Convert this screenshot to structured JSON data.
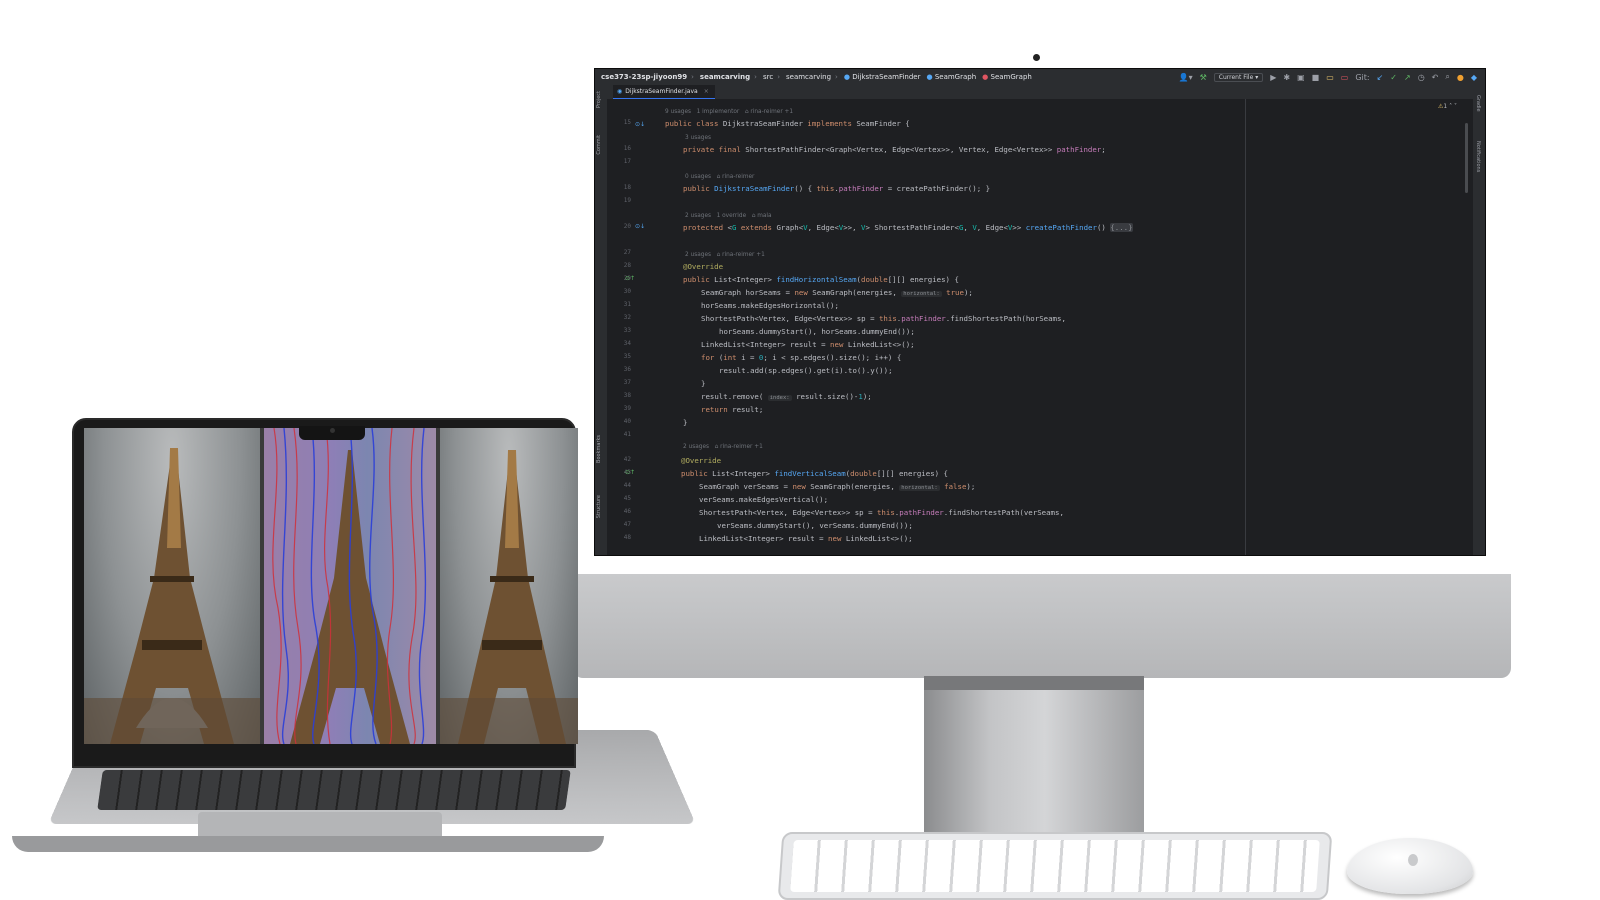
{
  "ide": {
    "breadcrumbs": [
      "cse373-23sp-jiyoon99",
      "seamcarving",
      "src",
      "seamcarving",
      "DijkstraSeamFinder",
      "SeamGraph",
      "SeamGraph"
    ],
    "run_config": "Current File",
    "git_label": "Git:",
    "tab": "DijkstraSeamFinder.java",
    "left_tools": [
      "Project",
      "Commit",
      "Bookmarks",
      "Structure"
    ],
    "right_tools": [
      "Gradle",
      "Notifications"
    ],
    "warnings": "1",
    "code": {
      "m1": "9 usages   1 implementor   ⌂ rina-reimer +1",
      "l15": "public class DijkstraSeamFinder implements SeamFinder {",
      "m2": "3 usages",
      "l16": "private final ShortestPathFinder<Graph<Vertex, Edge<Vertex>>, Vertex, Edge<Vertex>> pathFinder;",
      "m3": "0 usages   ⌂ rina-reimer",
      "l18": "public DijkstraSeamFinder() { this.pathFinder = createPathFinder(); }",
      "m4": "2 usages   1 override   ⌂ mala",
      "l20": "protected <G extends Graph<V, Edge<V>>, V> ShortestPathFinder<G, V, Edge<V>> createPathFinder() {...}",
      "m5": "2 usages   ⌂ rina-reimer +1",
      "l28": "@Override",
      "l29": "public List<Integer> findHorizontalSeam(double[][] energies) {",
      "l30": "SeamGraph horSeams = new SeamGraph(energies,  horizontal: true);",
      "l31": "horSeams.makeEdgesHorizontal();",
      "l32": "ShortestPath<Vertex, Edge<Vertex>> sp = this.pathFinder.findShortestPath(horSeams,",
      "l33": "horSeams.dummyStart(), horSeams.dummyEnd());",
      "l34": "LinkedList<Integer> result = new LinkedList<>();",
      "l35": "for (int i = 0; i < sp.edges().size(); i++) {",
      "l36": "result.add(sp.edges().get(i).to().y());",
      "l37": "}",
      "l38": "result.remove( index: result.size()-1);",
      "l39": "return result;",
      "l40": "}",
      "m6": "2 usages   ⌂ rina-reimer +1",
      "l42": "@Override",
      "l43": "public List<Integer> findVerticalSeam(double[][] energies) {",
      "l44": "SeamGraph verSeams = new SeamGraph(energies,  horizontal: false);",
      "l45": "verSeams.makeEdgesVertical();",
      "l46": "ShortestPath<Vertex, Edge<Vertex>> sp = this.pathFinder.findShortestPath(verSeams,",
      "l47": "verSeams.dummyStart(), verSeams.dummyEnd());",
      "l48": "LinkedList<Integer> result = new LinkedList<>();"
    },
    "line_numbers": [
      "15",
      "16",
      "17",
      "18",
      "19",
      "20",
      "27",
      "28",
      "29",
      "30",
      "31",
      "32",
      "33",
      "34",
      "35",
      "36",
      "37",
      "38",
      "39",
      "40",
      "41",
      "42",
      "43",
      "44",
      "45",
      "46",
      "47",
      "48"
    ]
  },
  "laptop": {
    "panels": [
      "original-image",
      "seam-visualization",
      "carved-image"
    ]
  },
  "colors": {
    "editor_bg": "#1e1f22",
    "keyword": "#cf8e6d",
    "function": "#56a8f5",
    "field": "#c77dbb",
    "annotation": "#b3ae60",
    "number": "#2aacb8",
    "seam_red": "#d0303a",
    "seam_blue": "#2b3fd8"
  }
}
